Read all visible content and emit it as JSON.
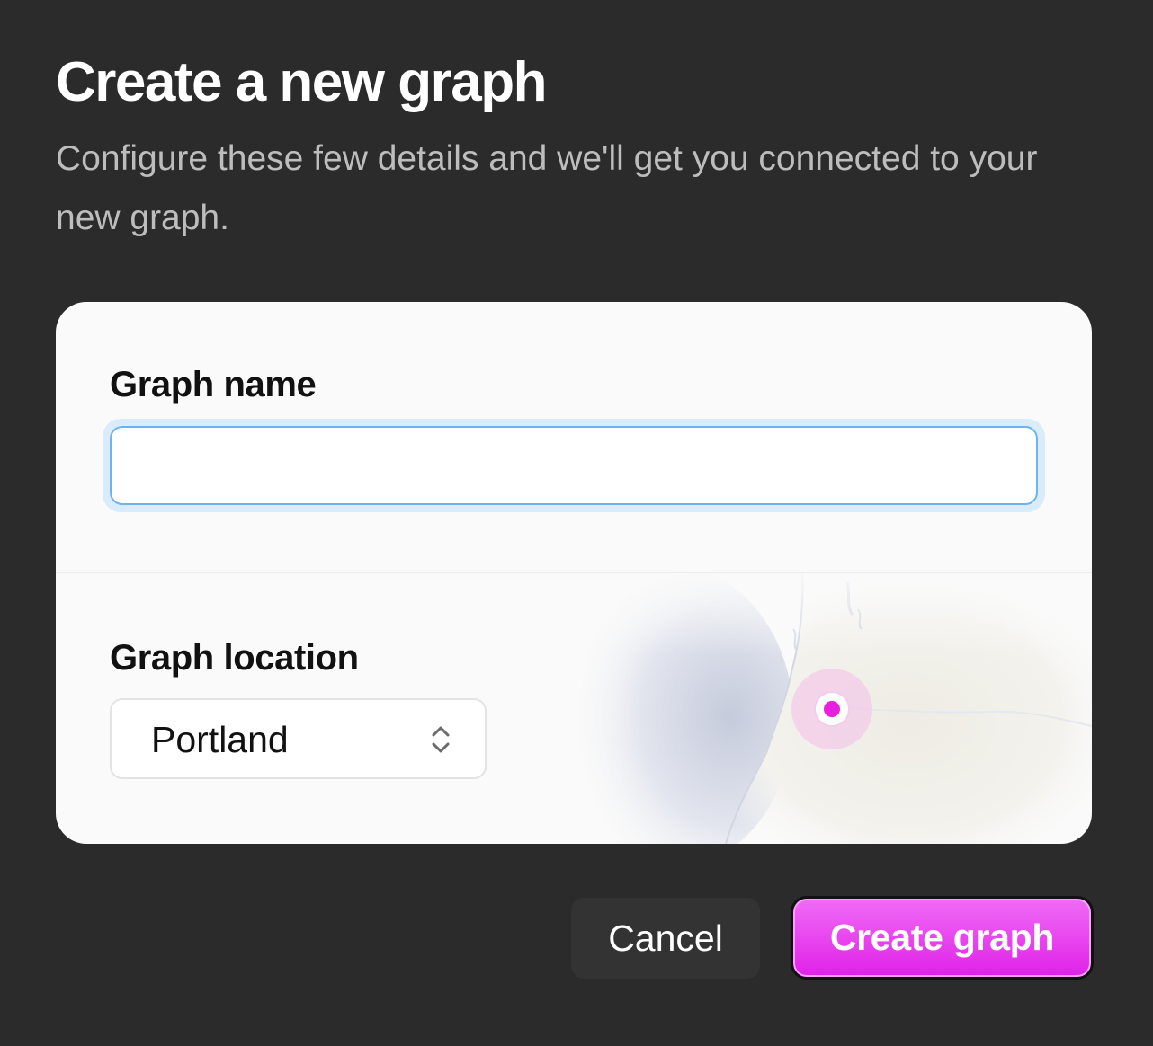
{
  "dialog": {
    "title": "Create a new graph",
    "subtitle": "Configure these few details and we'll get you connected to your new graph."
  },
  "form": {
    "name_field": {
      "label": "Graph name",
      "value": "",
      "placeholder": ""
    },
    "location_field": {
      "label": "Graph location",
      "selected": "Portland"
    }
  },
  "actions": {
    "cancel_label": "Cancel",
    "create_label": "Create graph"
  },
  "theme": {
    "background": "#2b2b2b",
    "accent": "#e936ee",
    "focus_ring": "#6fb3ec",
    "map_marker": "#e81fe0"
  },
  "icons": {
    "select": "chevron-up-down-icon",
    "map_marker": "location-dot-icon"
  }
}
